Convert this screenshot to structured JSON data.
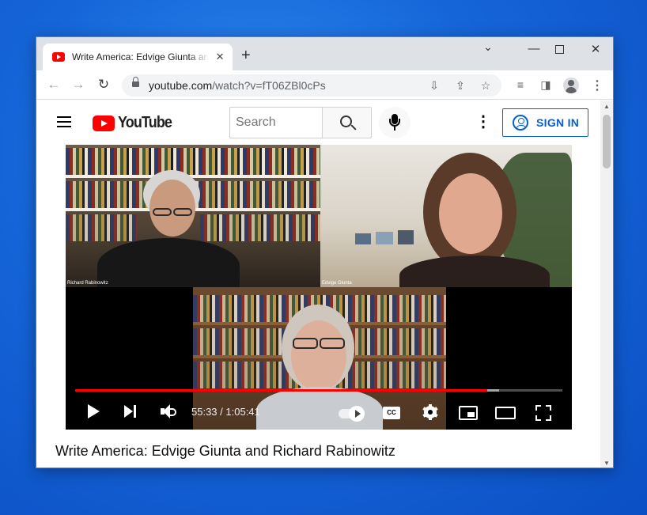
{
  "browser": {
    "tab": {
      "title": "Write America: Edvige Giunta and Richard Rabinowitz",
      "favicon": "youtube-favicon-icon"
    },
    "address": {
      "host": "youtube.com",
      "path": "/watch?v=fT06ZBl0cPs"
    }
  },
  "youtube": {
    "logo_text": "YouTube",
    "search": {
      "placeholder": "Search"
    },
    "signin_label": "SIGN IN"
  },
  "video": {
    "participants": [
      {
        "name": "Richard Rabinowitz"
      },
      {
        "name": "Edvige Giunta"
      }
    ],
    "current_time": "55:33",
    "separator": " / ",
    "duration": "1:05:41",
    "played_fraction": 0.846,
    "buffered_fraction": 0.87,
    "cc_label": "CC",
    "title": "Write America: Edvige Giunta and Richard Rabinowitz"
  },
  "colors": {
    "accent_red": "#ff0000",
    "signin_blue": "#065fd4",
    "desktop_blue": "#1565d8"
  }
}
